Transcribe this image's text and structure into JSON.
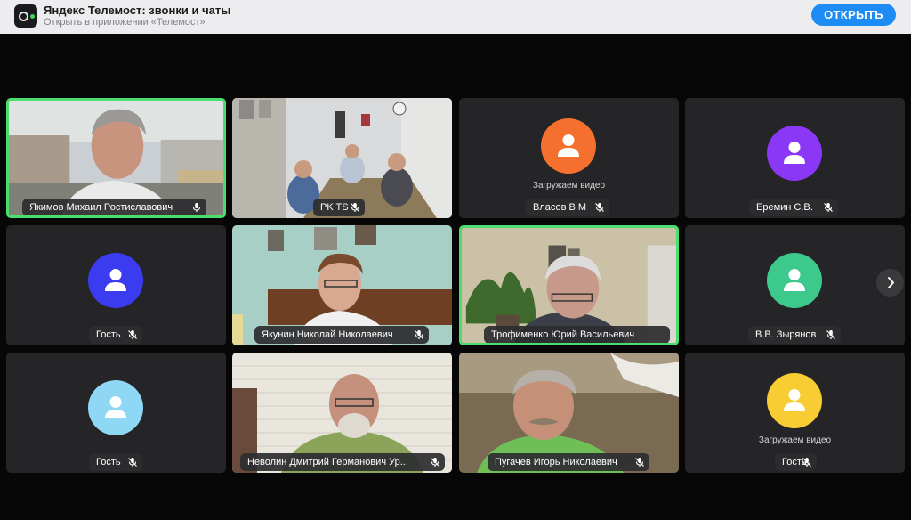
{
  "banner": {
    "app_name": "Яндекс Телемост: звонки и чаты",
    "subtitle": "Открыть в приложении «Телемост»",
    "open_label": "ОТКРЫТЬ"
  },
  "loading_text": "Загружаем видео",
  "participants": [
    {
      "name": "Якимов Михаил Ростиславович",
      "mic": "on",
      "video": true,
      "active": true
    },
    {
      "name": "PK TS",
      "mic": "muted",
      "video": true,
      "active": false
    },
    {
      "name": "Власов В М",
      "mic": "muted",
      "video": false,
      "avatar_color": "#f5702f",
      "loading": true
    },
    {
      "name": "Еремин С.В.",
      "mic": "muted",
      "video": false,
      "avatar_color": "#8a38f5",
      "loading": false
    },
    {
      "name": "Гость",
      "mic": "muted",
      "video": false,
      "avatar_color": "#3b3bf0",
      "loading": false
    },
    {
      "name": "Якунин Николай Николаевич",
      "mic": "muted",
      "video": true,
      "active": false
    },
    {
      "name": "Трофименко Юрий Васильевич",
      "mic": "none",
      "video": true,
      "active": true
    },
    {
      "name": "В.В. Зырянов",
      "mic": "muted",
      "video": false,
      "avatar_color": "#3ec98c",
      "loading": false
    },
    {
      "name": "Гость",
      "mic": "muted",
      "video": false,
      "avatar_color": "#8fd8f5",
      "loading": false
    },
    {
      "name": "Неволин Дмитрий Германович Ур...",
      "mic": "muted",
      "video": true,
      "active": false
    },
    {
      "name": "Пугачев Игорь Николаевич",
      "mic": "muted",
      "video": true,
      "active": false
    },
    {
      "name": "Гость",
      "mic": "muted",
      "video": false,
      "avatar_color": "#f7cd33",
      "loading": true
    }
  ],
  "icons": {
    "next_page": "chevron-right-icon",
    "avatar": "person-icon",
    "mic_on": "microphone-icon",
    "mic_muted": "microphone-off-icon"
  },
  "colors": {
    "active_border": "#4cde6c",
    "open_button": "#1e8cf5",
    "tile_bg": "#252527"
  }
}
